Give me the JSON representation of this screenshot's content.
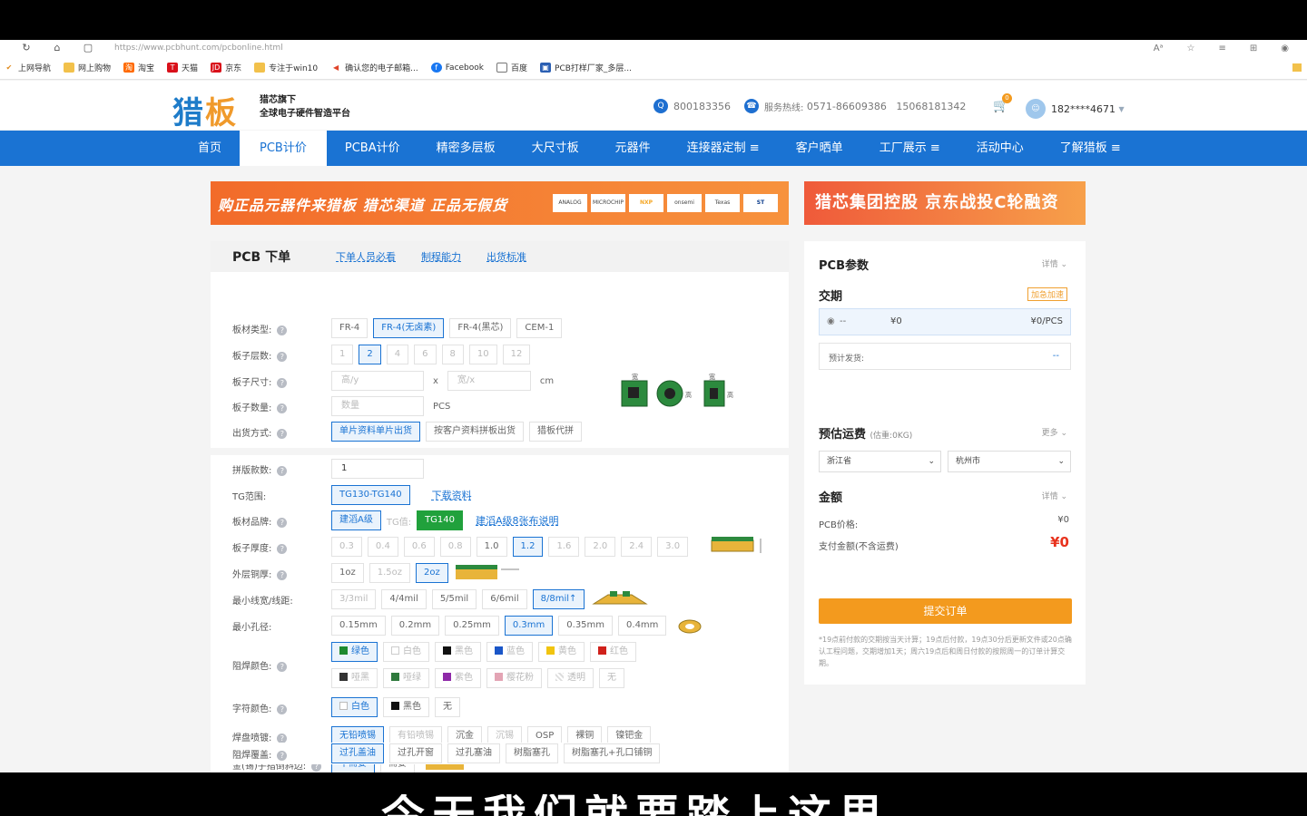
{
  "browser": {
    "url": "https://www.pcbhunt.com/pcbonline.html",
    "bookmarks": [
      "上网导航",
      "网上购物",
      "淘宝",
      "天猫",
      "京东",
      "专注于win10",
      "确认您的电子邮箱...",
      "Facebook",
      "百度",
      "PCB打样厂家_多层..."
    ]
  },
  "header": {
    "logo_text": "猎",
    "logo_text_b": "板",
    "slogan_line1": "猎芯旗下",
    "slogan_line2": "全球电子硬件智造平台",
    "qq": "800183356",
    "hotline_label": "服务热线:",
    "hotline": "0571-86609386",
    "mobile": "15068181342",
    "cart_count": "0",
    "user": "182****4671"
  },
  "nav": [
    "首页",
    "PCB计价",
    "PCBA计价",
    "精密多层板",
    "大尺寸板",
    "元器件",
    "连接器定制 ≡",
    "客户晒单",
    "工厂展示 ≡",
    "活动中心",
    "了解猎板 ≡"
  ],
  "banners": {
    "left": "购正品元器件来猎板  猎芯渠道  正品无假货",
    "brands": [
      "ANALOG DEVICES",
      "MICROCHIP",
      "NXP",
      "onsemi",
      "Texas Instruments",
      "ST"
    ],
    "right": "猎芯集团控股   京东战投C轮融资"
  },
  "order": {
    "title": "PCB 下单",
    "links": [
      "下单人员必看",
      "制程能力",
      "出货标准"
    ],
    "rows": {
      "material": {
        "label": "板材类型:",
        "options": [
          "FR-4",
          "FR-4(无卤素)",
          "FR-4(黑芯)",
          "CEM-1"
        ]
      },
      "layers": {
        "label": "板子层数:",
        "options": [
          "1",
          "2",
          "4",
          "6",
          "8",
          "10",
          "12"
        ]
      },
      "size": {
        "label": "板子尺寸:",
        "h_placeholder": "高/y",
        "x": "x",
        "w_placeholder": "宽/x",
        "unit": "cm"
      },
      "qty": {
        "label": "板子数量:",
        "placeholder": "数量",
        "unit": "PCS"
      },
      "ship": {
        "label": "出货方式:",
        "options": [
          "单片资料单片出货",
          "按客户资料拼板出货",
          "猎板代拼"
        ]
      },
      "panel": {
        "label": "拼版款数:",
        "value": "1"
      },
      "tg": {
        "label": "TG范围:",
        "options": [
          "TG130-TG140"
        ],
        "link": "下载资料"
      },
      "brand": {
        "label": "板材品牌:",
        "options": [
          "建滔A级"
        ],
        "tg_label": "TG值:",
        "tg_value": "TG140",
        "link": "建滔A级8张布说明"
      },
      "thickness": {
        "label": "板子厚度:",
        "options": [
          "0.3",
          "0.4",
          "0.6",
          "0.8",
          "1.0",
          "1.2",
          "1.6",
          "2.0",
          "2.4",
          "3.0"
        ]
      },
      "copper": {
        "label": "外层铜厚:",
        "options": [
          "1oz",
          "1.5oz",
          "2oz"
        ]
      },
      "trace": {
        "label": "最小线宽/线距:",
        "options": [
          "3/3mil",
          "4/4mil",
          "5/5mil",
          "6/6mil",
          "8/8mil↑"
        ]
      },
      "hole": {
        "label": "最小孔径:",
        "options": [
          "0.15mm",
          "0.2mm",
          "0.25mm",
          "0.3mm",
          "0.35mm",
          "0.4mm"
        ]
      },
      "mask": {
        "label": "阻焊颜色:",
        "row1": [
          "绿色",
          "白色",
          "黑色",
          "蓝色",
          "黄色",
          "红色"
        ],
        "row2": [
          "哑黑",
          "哑绿",
          "紫色",
          "樱花粉",
          "透明",
          "无"
        ]
      },
      "silk": {
        "label": "字符颜色:",
        "options": [
          "白色",
          "黑色",
          "无"
        ]
      },
      "surface": {
        "label": "焊盘喷镀:",
        "options": [
          "无铅喷锡",
          "有铅喷锡",
          "沉金",
          "沉锡",
          "OSP",
          "裸铜",
          "镍钯金"
        ]
      },
      "bevel": {
        "label": "金(锡)手指倒斜边:",
        "options": [
          "不需要",
          "需要"
        ]
      },
      "via": {
        "label": "阻焊覆盖:",
        "options": [
          "过孔盖油",
          "过孔开窗",
          "过孔塞油",
          "树脂塞孔",
          "树脂塞孔+孔口铺铜"
        ]
      }
    }
  },
  "sidebar": {
    "params_title": "PCB参数",
    "detail": "详情",
    "delivery_title": "交期",
    "urgent": "加急加速",
    "delivery_value": "--",
    "delivery_price": "¥0",
    "delivery_unit_price": "¥0/PCS",
    "ship_estimate_label": "预计发货:",
    "ship_estimate_value": "--",
    "freight_title": "预估运费",
    "freight_weight": "(估重:0KG)",
    "more": "更多",
    "province": "浙江省",
    "city": "杭州市",
    "amount_title": "金额",
    "pcb_price_label": "PCB价格:",
    "pcb_price": "¥0",
    "pay_label": "支付金额(不含运费)",
    "pay_value": "¥0",
    "submit": "提交订单",
    "note": "*19点前付款的交期按当天计算；19点后付款，19点30分后更新文件或20点确认工程问题，交期增加1天；周六19点后和周日付款的按照周一的订单计算交期。"
  },
  "subtitle": "今天我们就要踏上这里"
}
